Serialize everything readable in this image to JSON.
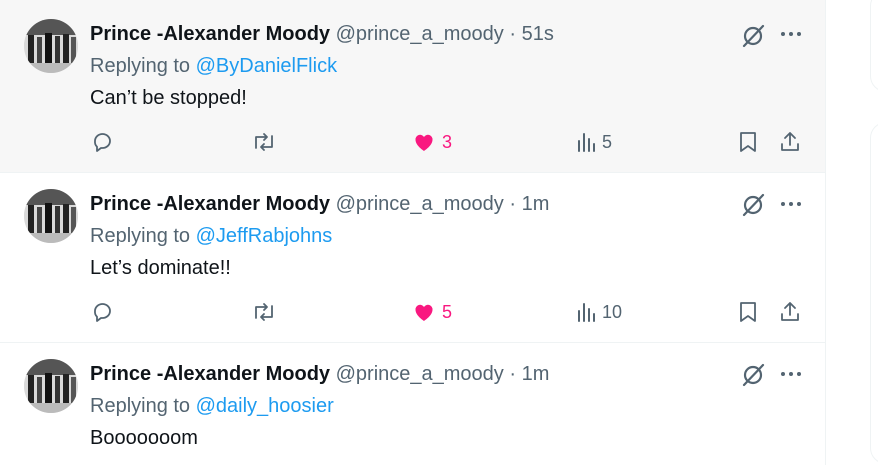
{
  "posts": [
    {
      "name": "Prince -Alexander Moody",
      "handle": "@prince_a_moody",
      "separator": "·",
      "time": "51s",
      "replying_prefix": "Replying to",
      "replying_to": "@ByDanielFlick",
      "text": "Can’t be stopped!",
      "likes": "3",
      "views": "5",
      "liked": true
    },
    {
      "name": "Prince -Alexander Moody",
      "handle": "@prince_a_moody",
      "separator": "·",
      "time": "1m",
      "replying_prefix": "Replying to",
      "replying_to": "@JeffRabjohns",
      "text": "Let’s dominate!!",
      "likes": "5",
      "views": "10",
      "liked": true
    },
    {
      "name": "Prince -Alexander Moody",
      "handle": "@prince_a_moody",
      "separator": "·",
      "time": "1m",
      "replying_prefix": "Replying to",
      "replying_to": "@daily_hoosier",
      "text": "Booooooom"
    }
  ],
  "colors": {
    "like": "#f91880",
    "mention": "#1d9bf0",
    "muted": "#536471",
    "hover_bg": "#f7f7f7"
  },
  "icons": [
    "reply-icon",
    "repost-icon",
    "heart-icon",
    "views-icon",
    "bookmark-icon",
    "share-icon",
    "grok-icon",
    "more-icon"
  ]
}
